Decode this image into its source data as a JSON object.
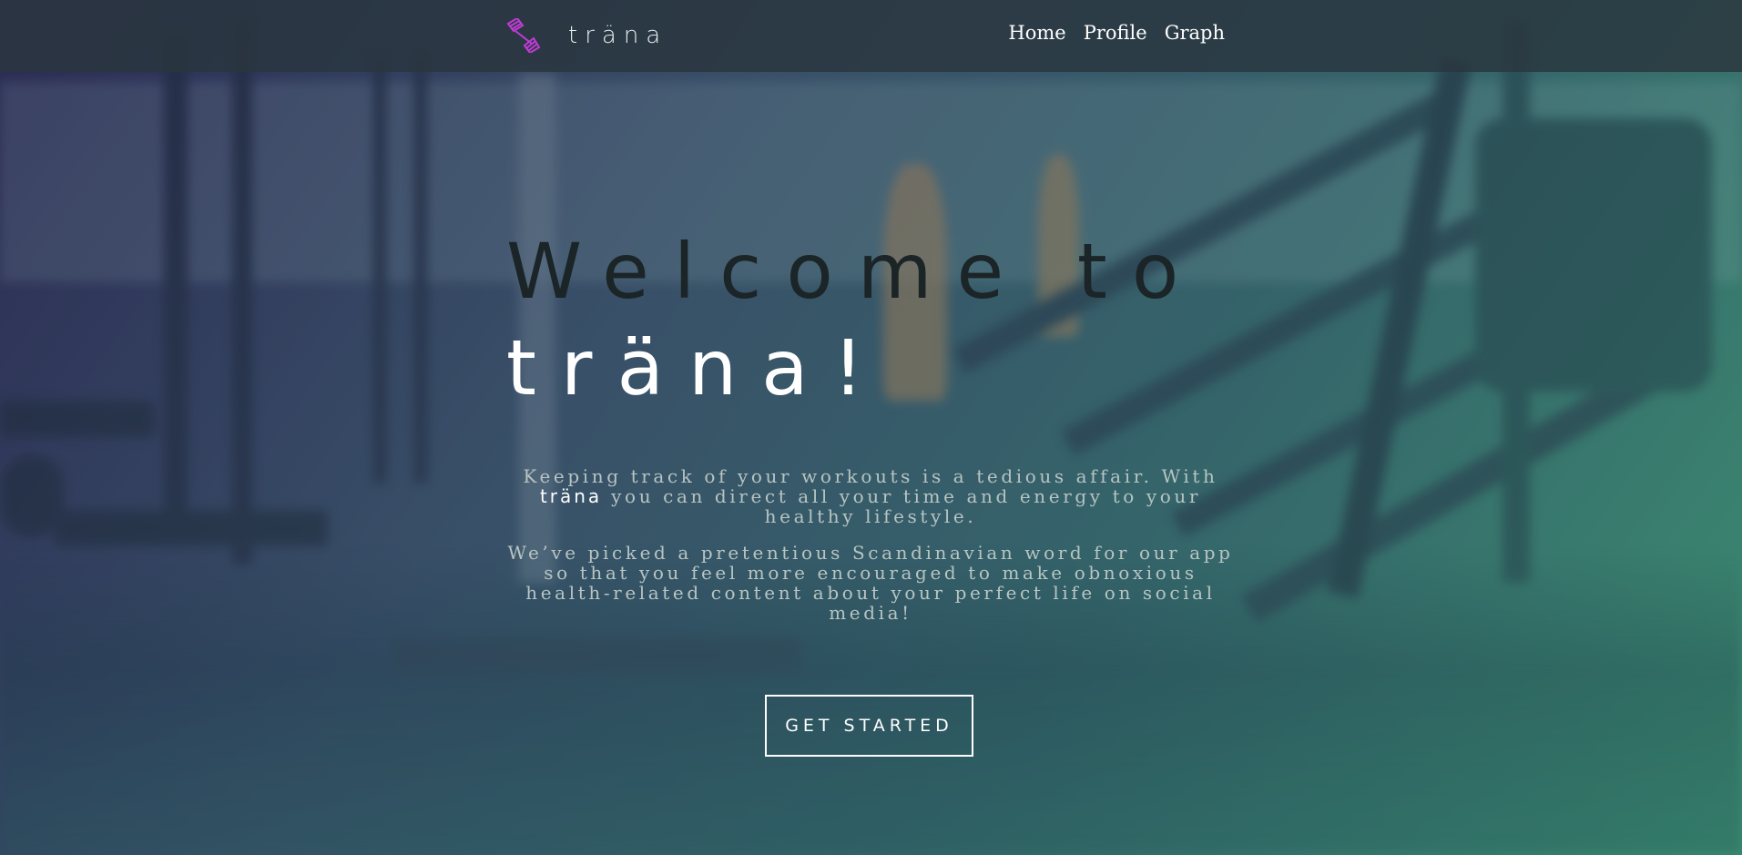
{
  "brand": {
    "name": "träna",
    "logo_icon": "dumbbell-logo-icon",
    "accent_color": "#c23ad6"
  },
  "nav": {
    "items": [
      {
        "label": "Home"
      },
      {
        "label": "Profile"
      },
      {
        "label": "Graph"
      }
    ]
  },
  "hero": {
    "title_line1": "Welcome to",
    "title_line2": "träna!",
    "description": {
      "p1_before": "Keeping track of your workouts is a tedious affair. With ",
      "p1_brand": "träna",
      "p1_after": " you can direct all your time and energy to your healthy lifestyle.",
      "p2": "We’ve picked a pretentious Scandinavian word for our app so that you feel more encouraged to make obnoxious health-related content about your perfect life on social media!"
    },
    "cta_label": "GET STARTED"
  }
}
